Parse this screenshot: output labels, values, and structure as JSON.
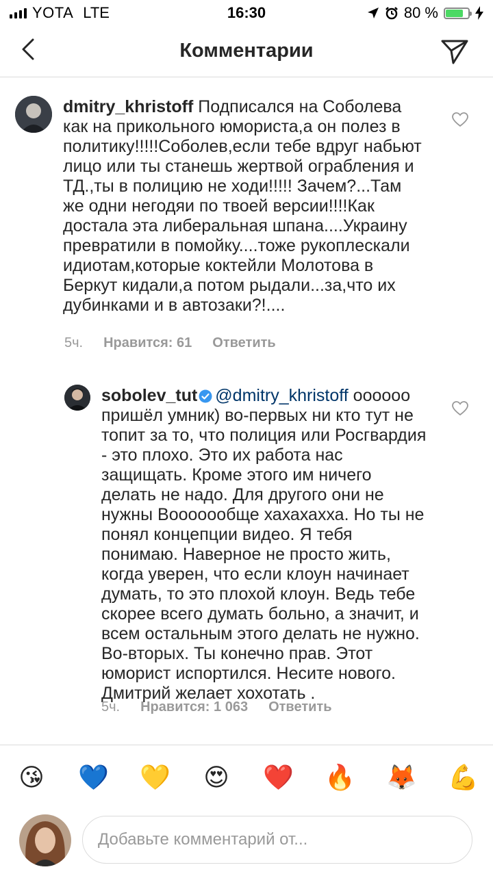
{
  "status_bar": {
    "carrier": "YOTA",
    "network": "LTE",
    "time": "16:30",
    "battery_text": "80 %",
    "battery_level": 0.8,
    "icons": [
      "signal-icon",
      "location-arrow-icon",
      "alarm-clock-icon",
      "battery-icon",
      "charging-bolt-icon"
    ]
  },
  "header": {
    "title": "Комментарии",
    "back_icon": "chevron-left-icon",
    "share_icon": "paper-plane-icon"
  },
  "comments": [
    {
      "username": "dmitry_khristoff",
      "verified": false,
      "mention": "",
      "text": "Подписался на Соболева как на прикольного юмориста,а он полез в политику!!!!!Соболев,если тебе вдруг набьют лицо или ты станешь жертвой ограбления и ТД.,ты в полицию не ходи!!!!! Зачем?...Там же одни негодяи по твоей версии!!!!Как достала эта либеральная шпана....Украину превратили в помойку....тоже рукоплескали идиотам,которые коктейли Молотова в Беркут кидали,а потом рыдали...за,что их дубинками и в автозаки?!....",
      "time": "5ч.",
      "likes": "Нравится: 61",
      "reply": "Ответить"
    },
    {
      "username": "sobolev_tut",
      "verified": true,
      "mention": "@dmitry_khristoff",
      "text": "оооооо пришёл умник) во-первых ни кто тут не топит за то,  что полиция или Росгвардия - это плохо. Это их работа нас защищать. Кроме этого им ничего делать не надо. Для другого они не нужны Вооооообще хахахахха. Но ты не понял концепции видео. Я тебя понимаю. Наверное не просто жить, когда уверен, что если клоун начинает думать, то это плохой клоун. Ведь тебе скорее всего думать больно, а значит, и всем остальным этого делать не нужно.  Во-вторых. Ты конечно прав. Этот юморист испортился. Несите нового. Дмитрий желает хохотать .",
      "time": "5ч.",
      "likes": "Нравится: 1 063",
      "reply": "Ответить"
    }
  ],
  "emoji_bar": [
    {
      "name": "kissing-face-icon",
      "glyph": "😘"
    },
    {
      "name": "blue-heart-icon",
      "glyph": "💙"
    },
    {
      "name": "yellow-heart-icon",
      "glyph": "💛"
    },
    {
      "name": "heart-eyes-icon",
      "glyph": "😍"
    },
    {
      "name": "red-heart-icon",
      "glyph": "❤️"
    },
    {
      "name": "fire-icon",
      "glyph": "🔥"
    },
    {
      "name": "fox-icon",
      "glyph": "🦊"
    },
    {
      "name": "flexed-biceps-icon",
      "glyph": "💪"
    }
  ],
  "composer": {
    "placeholder": "Добавьте комментарий от..."
  },
  "colors": {
    "text": "#262626",
    "meta": "#999999",
    "mention": "#003569",
    "verified": "#3897f0",
    "divider": "#dbdbdb"
  }
}
